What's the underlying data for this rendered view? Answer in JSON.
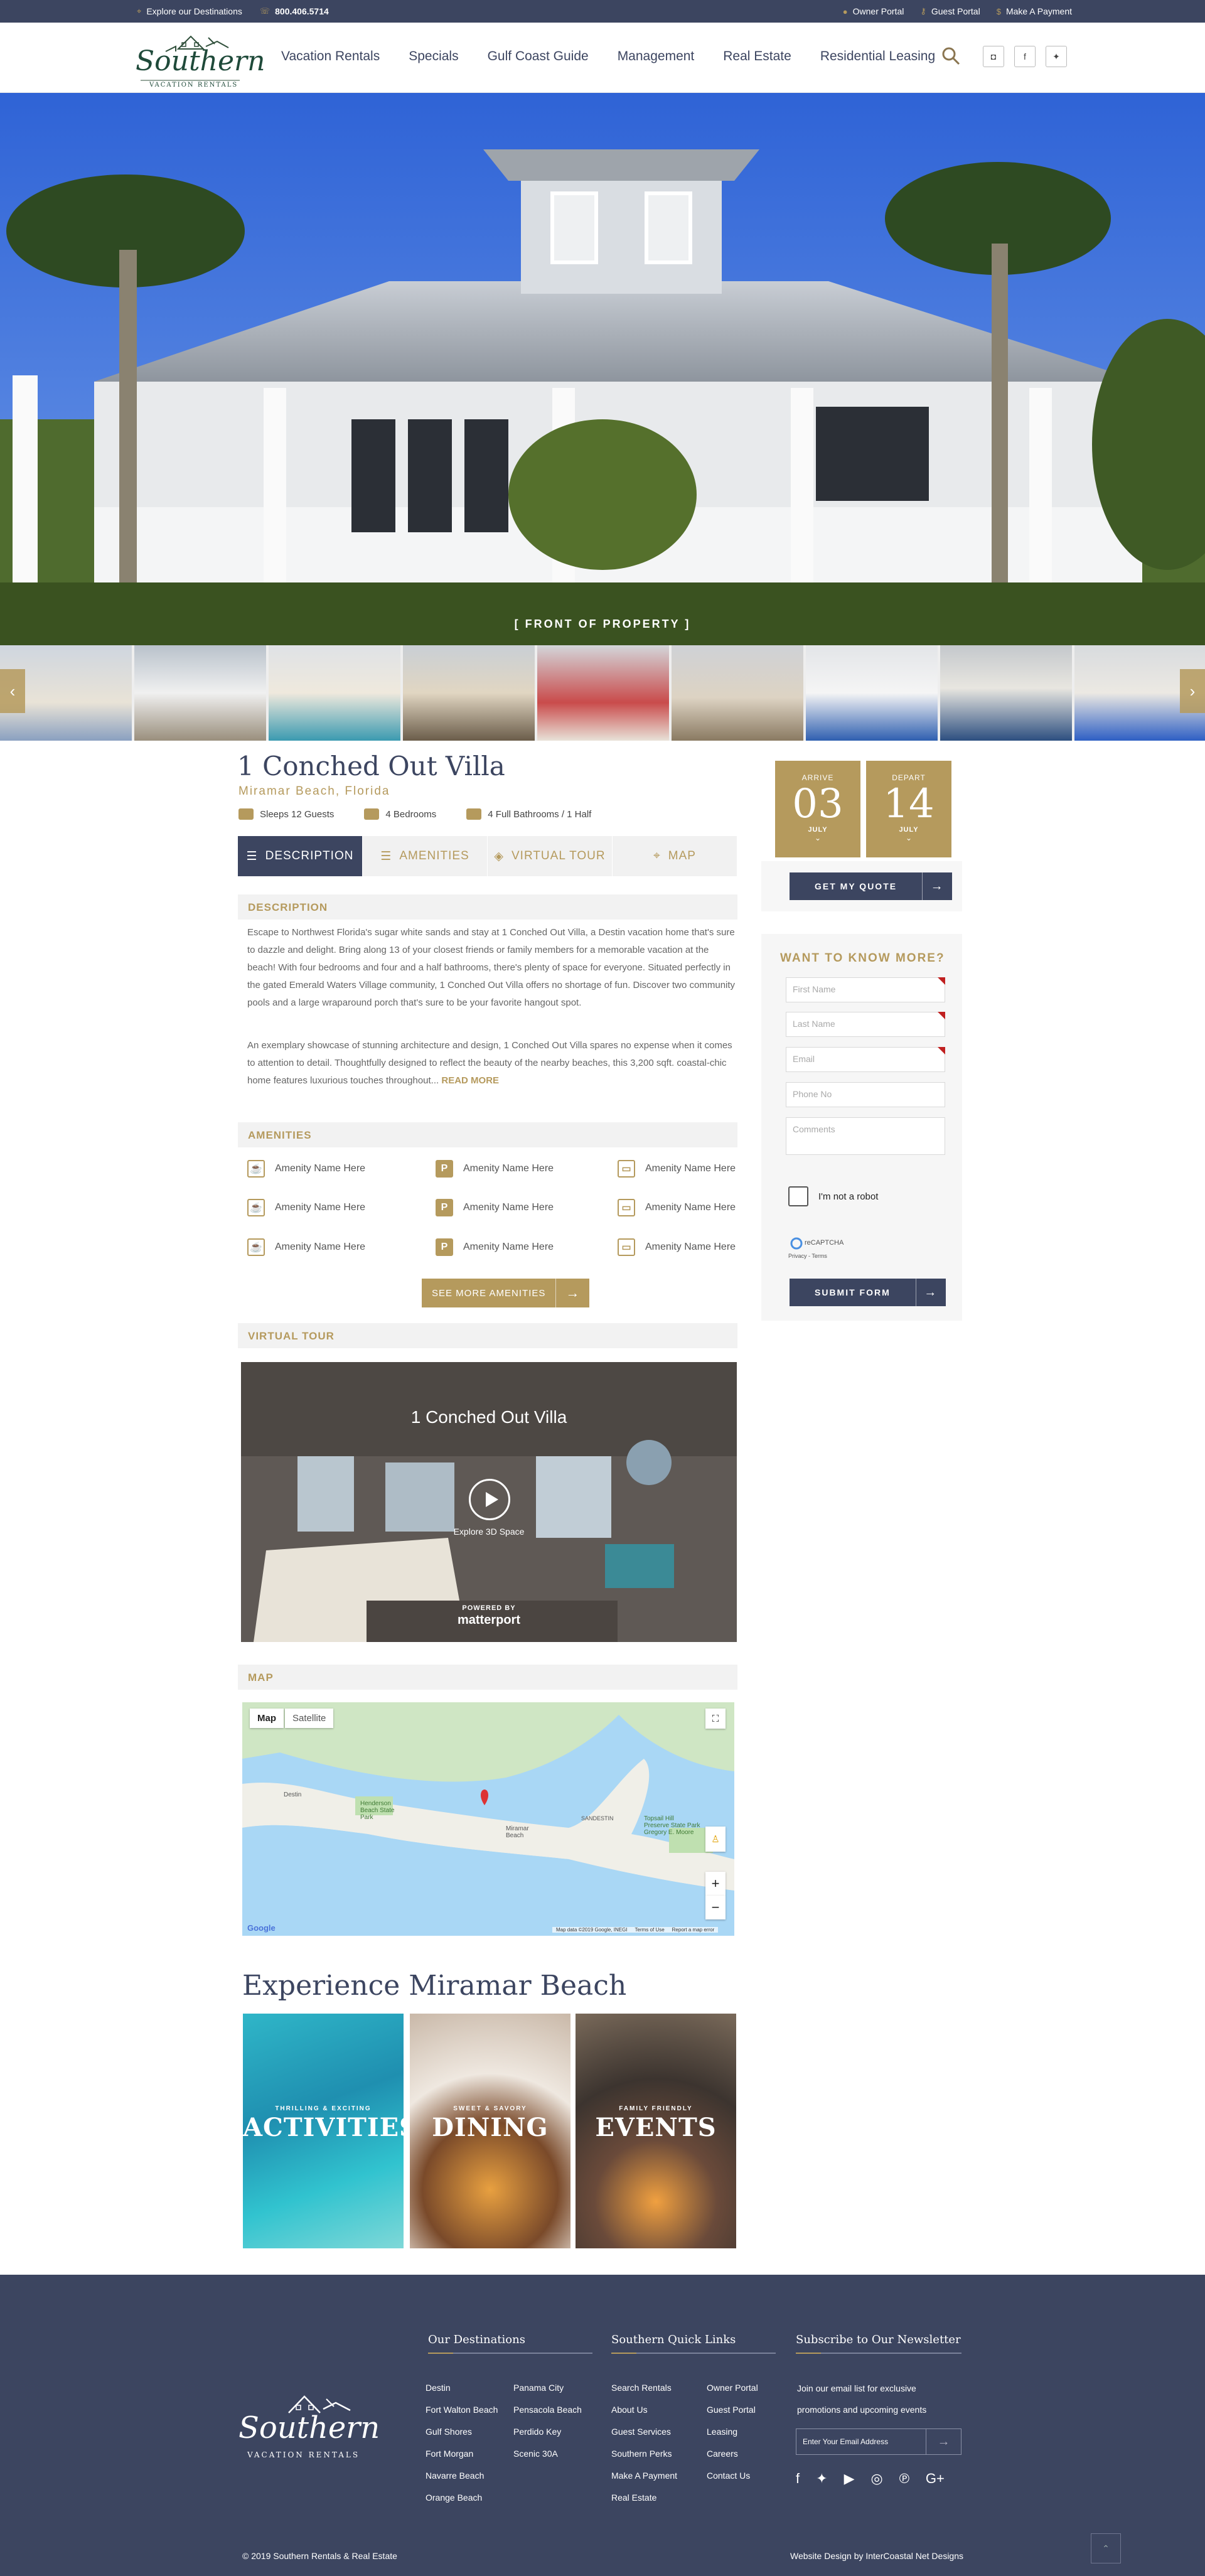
{
  "topbar": {
    "destinations": "Explore our Destinations",
    "phone": "800.406.5714",
    "owner_portal": "Owner Portal",
    "guest_portal": "Guest Portal",
    "payment": "Make A Payment"
  },
  "logo": {
    "name": "Southern",
    "tagline": "VACATION RENTALS"
  },
  "nav": [
    "Vacation Rentals",
    "Specials",
    "Gulf Coast Guide",
    "Management",
    "Real Estate",
    "Residential Leasing"
  ],
  "hero": {
    "caption": "[  FRONT OF PROPERTY  ]"
  },
  "property": {
    "title": "1 Conched Out Villa",
    "location": "Miramar Beach, Florida",
    "sleeps": "Sleeps 12 Guests",
    "bedrooms": "4 Bedrooms",
    "bathrooms": "4 Full Bathrooms / 1 Half"
  },
  "tabs": [
    "DESCRIPTION",
    "AMENITIES",
    "VIRTUAL TOUR",
    "MAP"
  ],
  "description": {
    "heading": "DESCRIPTION",
    "p1": "Escape to Northwest Florida's sugar white sands and stay at 1 Conched Out Villa, a Destin vacation home that's sure to dazzle and delight. Bring along 13 of your closest friends or family members for a memorable vacation at the beach! With four bedrooms and four and a half bathrooms, there's plenty of space for everyone. Situated perfectly in the gated Emerald Waters Village community, 1 Conched Out Villa offers no shortage of fun. Discover two community pools and a large wraparound porch that's sure to be your favorite hangout spot.",
    "p2": "An exemplary showcase of stunning architecture and design, 1 Conched Out Villa spares no expense when it comes to attention to detail. Thoughtfully designed to reflect the beauty of the nearby beaches, this 3,200 sqft. coastal-chic home features luxurious touches throughout...",
    "read_more": "READ MORE"
  },
  "amenities": {
    "heading": "AMENITIES",
    "item": "Amenity Name Here",
    "button": "SEE MORE AMENITIES"
  },
  "tour": {
    "heading": "VIRTUAL TOUR",
    "title": "1 Conched Out Villa",
    "sub": "Explore 3D Space",
    "powered": "POWERED BY",
    "brand": "matterport"
  },
  "map": {
    "heading": "MAP",
    "tab_map": "Map",
    "tab_sat": "Satellite",
    "labels": [
      "Destin",
      "Henderson Beach State Park",
      "Miramar Beach",
      "SANDESTIN",
      "Topsail Hill Preserve State Park Gregory E. Moore",
      "Google",
      "Map data ©2019 Google, INEGI",
      "Terms of Use",
      "Report a map error"
    ]
  },
  "experience": {
    "title": "Experience Miramar Beach",
    "cards": [
      {
        "kicker": "THRILLING & EXCITING",
        "big": "ACTIVITIES"
      },
      {
        "kicker": "SWEET & SAVORY",
        "big": "DINING"
      },
      {
        "kicker": "FAMILY FRIENDLY",
        "big": "EVENTS"
      }
    ]
  },
  "booking": {
    "arrive_label": "ARRIVE",
    "arrive_day": "03",
    "arrive_month": "JULY",
    "depart_label": "DEPART",
    "depart_day": "14",
    "depart_month": "JULY",
    "quote": "GET MY QUOTE"
  },
  "form": {
    "title": "WANT TO KNOW MORE?",
    "first": "First Name",
    "last": "Last Name",
    "email": "Email",
    "phone": "Phone No",
    "comments": "Comments",
    "robot": "I'm not a robot",
    "recaptcha": "reCAPTCHA",
    "privacy": "Privacy - Terms",
    "submit": "SUBMIT FORM"
  },
  "footer": {
    "dest_head": "Our Destinations",
    "dest_col1": [
      "Destin",
      "Fort Walton Beach",
      "Gulf Shores",
      "Fort Morgan",
      "Navarre Beach",
      "Orange Beach"
    ],
    "dest_col2": [
      "Panama City",
      "Pensacola Beach",
      "Perdido Key",
      "Scenic 30A"
    ],
    "links_head": "Southern Quick Links",
    "links_col1": [
      "Search Rentals",
      "About Us",
      "Guest Services",
      "Southern Perks",
      "Make A Payment",
      "Real Estate"
    ],
    "links_col2": [
      "Owner Portal",
      "Guest Portal",
      "Leasing",
      "Careers",
      "Contact Us"
    ],
    "news_head": "Subscribe to Our Newsletter",
    "news_text": "Join our email list for exclusive promotions and upcoming events",
    "email_placeholder": "Enter Your Email Address",
    "copyright": "© 2019 Southern Rentals & Real Estate",
    "credit": "Website Design by InterCoastal Net Designs"
  },
  "colors": {
    "navy": "#3c4560",
    "gold": "#b59a5d"
  }
}
